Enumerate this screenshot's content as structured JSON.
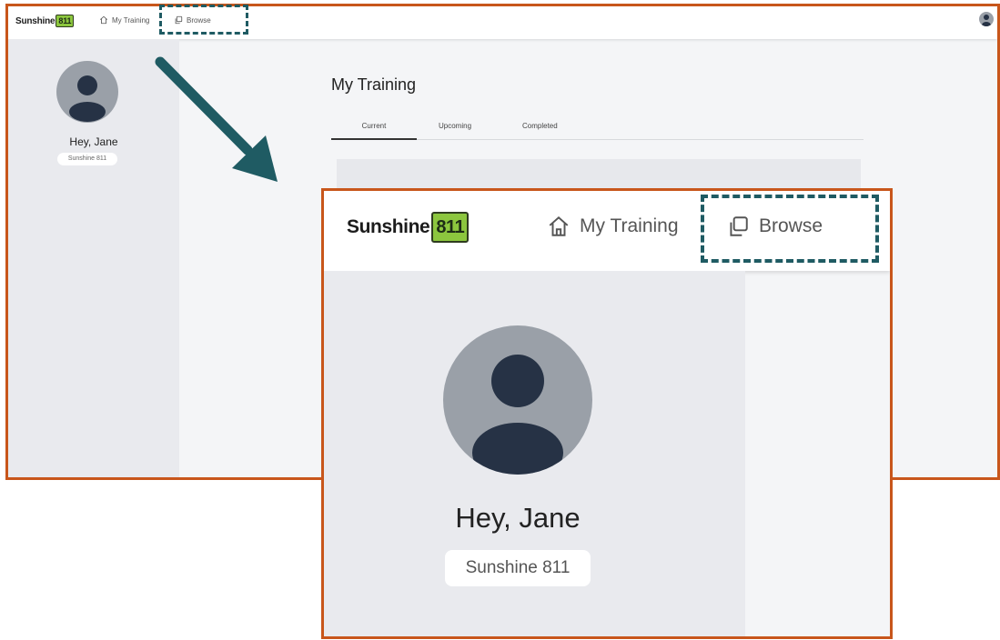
{
  "app": {
    "logo_text": "Sunshine",
    "logo_number": "811"
  },
  "nav": {
    "my_training_label": "My Training",
    "browse_label": "Browse",
    "my_training_icon": "home-icon",
    "browse_icon": "copy-icon"
  },
  "user": {
    "greeting": "Hey, Jane",
    "organization": "Sunshine 811"
  },
  "main": {
    "title": "My Training",
    "tabs": [
      {
        "label": "Current",
        "active": true
      },
      {
        "label": "Upcoming",
        "active": false
      },
      {
        "label": "Completed",
        "active": false
      }
    ]
  },
  "colors": {
    "callout_border": "#c8561b",
    "highlight_dash": "#1f5b63",
    "arrow": "#1f5b63",
    "logo_accent": "#8cc63e",
    "avatar_bg": "#9aa0a8",
    "avatar_fg": "#263245"
  }
}
